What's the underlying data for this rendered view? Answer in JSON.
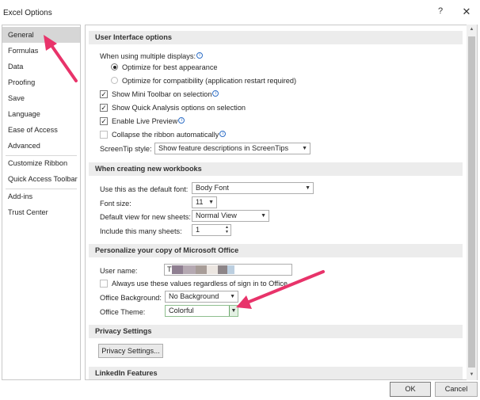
{
  "window": {
    "title": "Excel Options",
    "help": "?",
    "close": "✕"
  },
  "nav": {
    "items": [
      {
        "label": "General"
      },
      {
        "label": "Formulas"
      },
      {
        "label": "Data"
      },
      {
        "label": "Proofing"
      },
      {
        "label": "Save"
      },
      {
        "label": "Language"
      },
      {
        "label": "Ease of Access"
      },
      {
        "label": "Advanced"
      },
      {
        "label": "Customize Ribbon"
      },
      {
        "label": "Quick Access Toolbar"
      },
      {
        "label": "Add-ins"
      },
      {
        "label": "Trust Center"
      }
    ]
  },
  "ui_options": {
    "header": "User Interface options",
    "multiple_displays_label": "When using multiple displays:",
    "optimize_best": "Optimize for best appearance",
    "optimize_compat": "Optimize for compatibility (application restart required)",
    "mini_toolbar": "Show Mini Toolbar on selection",
    "quick_analysis": "Show Quick Analysis options on selection",
    "live_preview": "Enable Live Preview",
    "collapse_ribbon": "Collapse the ribbon automatically",
    "screentip_label": "ScreenTip style:",
    "screentip_value": "Show feature descriptions in ScreenTips"
  },
  "new_workbooks": {
    "header": "When creating new workbooks",
    "font_label": "Use this as the default font:",
    "font_value": "Body Font",
    "size_label": "Font size:",
    "size_value": "11",
    "view_label": "Default view for new sheets:",
    "view_value": "Normal View",
    "sheets_label": "Include this many sheets:",
    "sheets_value": "1"
  },
  "personalize": {
    "header": "Personalize your copy of Microsoft Office",
    "username_label": "User name:",
    "username_value": "T",
    "always_use": "Always use these values regardless of sign in to Office.",
    "background_label": "Office Background:",
    "background_value": "No Background",
    "theme_label": "Office Theme:",
    "theme_value": "Colorful"
  },
  "privacy": {
    "header": "Privacy Settings",
    "button": "Privacy Settings..."
  },
  "linkedin": {
    "header": "LinkedIn Features"
  },
  "footer": {
    "ok": "OK",
    "cancel": "Cancel"
  },
  "colors": {
    "highlight_arrow": "#e8336a",
    "selected_nav": "#d6d6d6",
    "section_bg": "#ececec"
  }
}
